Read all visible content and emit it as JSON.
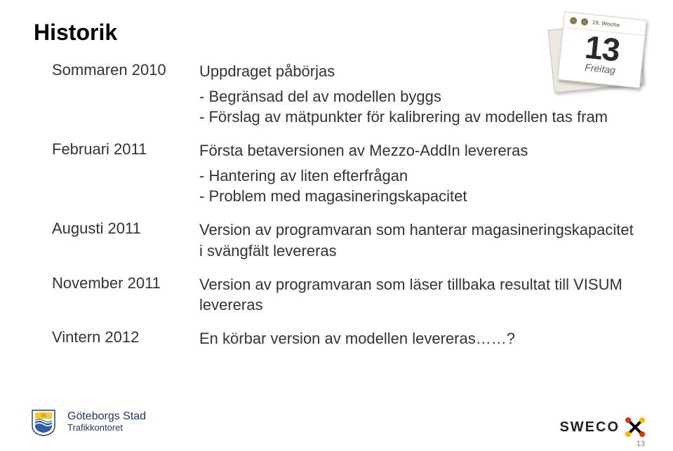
{
  "title": "Historik",
  "rows": [
    {
      "label": "Sommaren 2010",
      "main": "Uppdraget påbörjas",
      "sub": [
        "- Begränsad del av modellen byggs",
        "- Förslag av mätpunkter för kalibrering av modellen tas fram"
      ]
    },
    {
      "label": "Februari 2011",
      "main": "Första betaversionen av Mezzo-AddIn levereras",
      "sub": [
        "- Hantering av liten efterfrågan",
        "- Problem med magasineringskapacitet"
      ]
    },
    {
      "label": "Augusti 2011",
      "main": "Version av programvaran som hanterar magasineringskapacitet i svängfält levereras",
      "sub": []
    },
    {
      "label": "November 2011",
      "main": "Version av programvaran som läser tillbaka resultat till VISUM levereras",
      "sub": []
    },
    {
      "label": "Vintern 2012",
      "main": "En körbar version av modellen levereras……?",
      "sub": []
    }
  ],
  "calendar": {
    "week": "19. Woche",
    "number": "13",
    "day": "Freitag"
  },
  "footer": {
    "gbg_line1": "Göteborgs Stad",
    "gbg_line2": "Trafikkontoret",
    "sweco": "SWECO",
    "page": "13"
  }
}
